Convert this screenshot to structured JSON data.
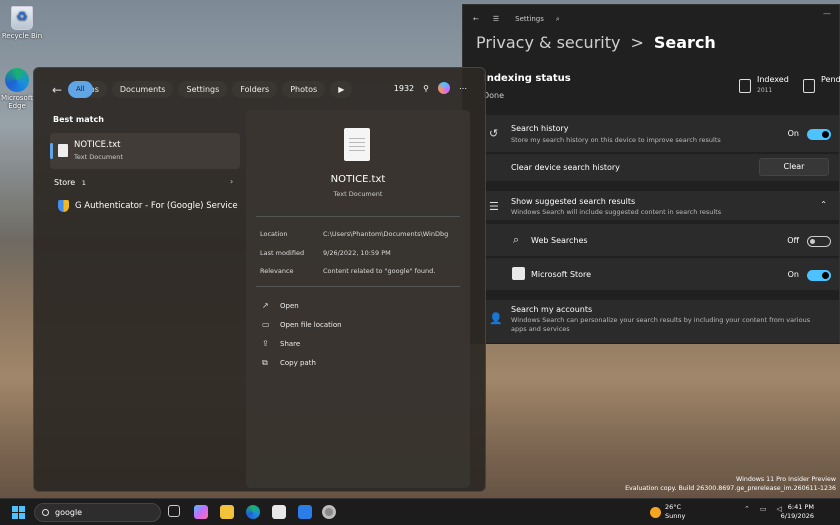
{
  "desktop": {
    "recycle_bin": "Recycle Bin",
    "edge": "Microsoft Edge"
  },
  "settings": {
    "app_title": "Settings",
    "breadcrumb_parent": "Privacy & security",
    "breadcrumb_sep": ">",
    "breadcrumb_current": "Search",
    "indexing_title": "Indexing status",
    "indexing_sub": "Done",
    "indexed_label": "Indexed",
    "indexed_value": "2011",
    "pending_label": "Pending",
    "search_history_title": "Search history",
    "search_history_sub": "Store my search history on this device to improve search results",
    "search_history_state": "On",
    "clear_history_title": "Clear device search history",
    "clear_button": "Clear",
    "suggested_title": "Show suggested search results",
    "suggested_sub": "Windows Search will include suggested content in search results",
    "web_searches": "Web Searches",
    "web_state": "Off",
    "ms_store": "Microsoft Store",
    "store_state": "On",
    "accounts_title": "Search my accounts",
    "accounts_sub": "Windows Search can personalize your search results by including your content from various apps and services"
  },
  "search_panel": {
    "filters": [
      "All",
      "Apps",
      "Documents",
      "Settings",
      "Folders",
      "Photos"
    ],
    "count": "1932",
    "best_match_label": "Best match",
    "best_name": "NOTICE.txt",
    "best_type": "Text Document",
    "store_label": "Store",
    "store_count": "1",
    "store_item": "G Authenticator - For (Google) Service",
    "preview": {
      "name": "NOTICE.txt",
      "type": "Text Document",
      "location_key": "Location",
      "location_val": "C:\\Users\\Phantom\\Documents\\WinDbg",
      "modified_key": "Last modified",
      "modified_val": "9/26/2022, 10:59 PM",
      "relevance_key": "Relevance",
      "relevance_val": "Content related to \"google\" found."
    },
    "actions": [
      "Open",
      "Open file location",
      "Share",
      "Copy path"
    ]
  },
  "taskbar": {
    "search_value": "google",
    "weather_temp": "26°C",
    "weather_cond": "Sunny",
    "time": "6:41 PM",
    "date": "6/19/2026"
  },
  "watermark": {
    "line1": "Windows 11 Pro Insider Preview",
    "line2": "Evaluation copy. Build 26300.8697.ge_prerelease_im.260611-1236"
  }
}
